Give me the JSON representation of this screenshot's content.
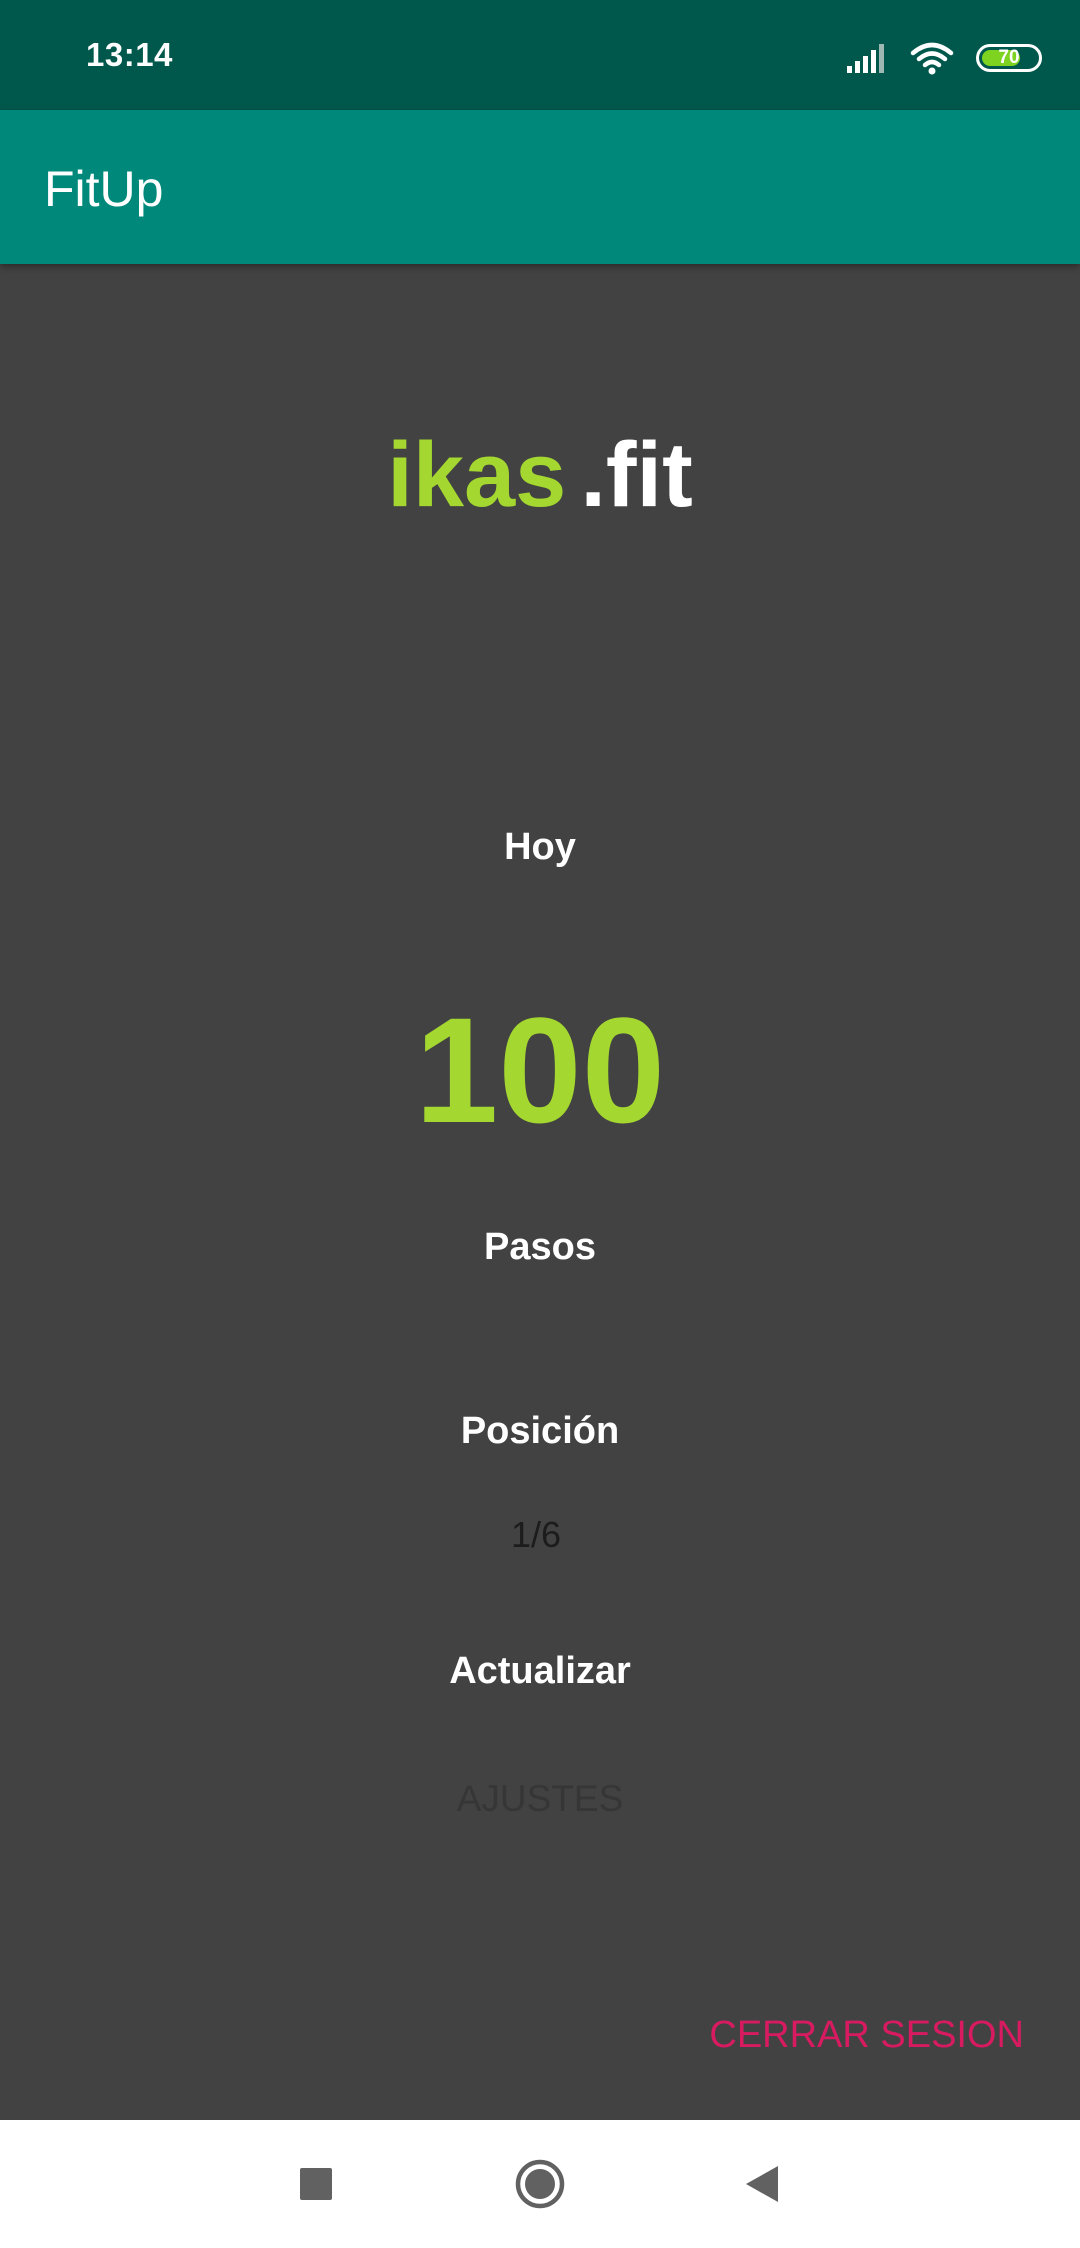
{
  "status_bar": {
    "time": "13:14",
    "battery_level": "70",
    "battery_fraction": 0.7,
    "icons": [
      "signal-icon",
      "wifi-icon",
      "battery-icon"
    ]
  },
  "app_bar": {
    "title": "FitUp"
  },
  "logo": {
    "part1": "ikas",
    "part2": ".fit"
  },
  "stats": {
    "today_label": "Hoy",
    "steps_value": "100",
    "steps_label": "Pasos",
    "position_label": "Posición",
    "position_value": "1/6"
  },
  "actions": {
    "update_label": "Actualizar",
    "settings_label": "AJUSTES",
    "logout_label": "CERRAR SESION"
  },
  "nav_bar": {
    "icons": [
      "recents-icon",
      "home-icon",
      "back-icon"
    ]
  },
  "colors": {
    "status_bar": "#00574b",
    "app_bar": "#00897b",
    "background": "#424242",
    "accent_green": "#a4d72f",
    "logout_pink": "#d81b60"
  }
}
